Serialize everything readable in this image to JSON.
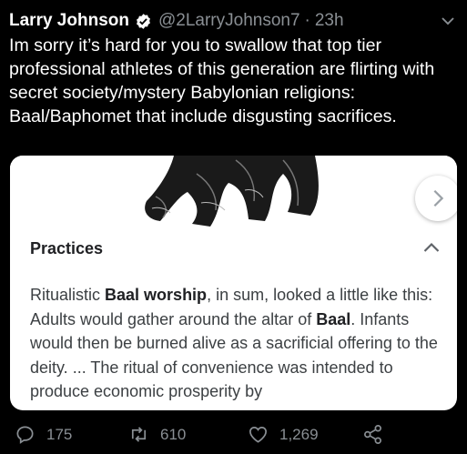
{
  "tweet": {
    "author_name": "Larry Johnson",
    "handle": "@2LarryJohnson7",
    "separator": "·",
    "time": "23h",
    "text": "Im sorry it’s hard for you to swallow that top tier professional athletes of this generation are flirting with secret society/mystery Babylonian religions: Baal/Baphomet that include disgusting sacrifices."
  },
  "card": {
    "section_title": "Practices",
    "body": {
      "t1": "Ritualistic ",
      "b1": "Baal worship",
      "t2": ", in sum, looked a little like this: Adults would gather around the altar of ",
      "b2": "Baal",
      "t3": ". Infants would then be burned alive as a sacrificial offering to the deity. ... The ritual of convenience was intended to produce economic prosperity by"
    }
  },
  "actions": {
    "replies": "175",
    "retweets": "610",
    "likes": "1,269"
  },
  "colors": {
    "background": "#000000",
    "muted": "#8a8f94",
    "card": "#ffffff"
  },
  "icons": [
    "verified-badge-icon",
    "chevron-down-icon",
    "chevron-right-icon",
    "chevron-up-icon",
    "reply-icon",
    "retweet-icon",
    "like-icon",
    "share-icon"
  ]
}
